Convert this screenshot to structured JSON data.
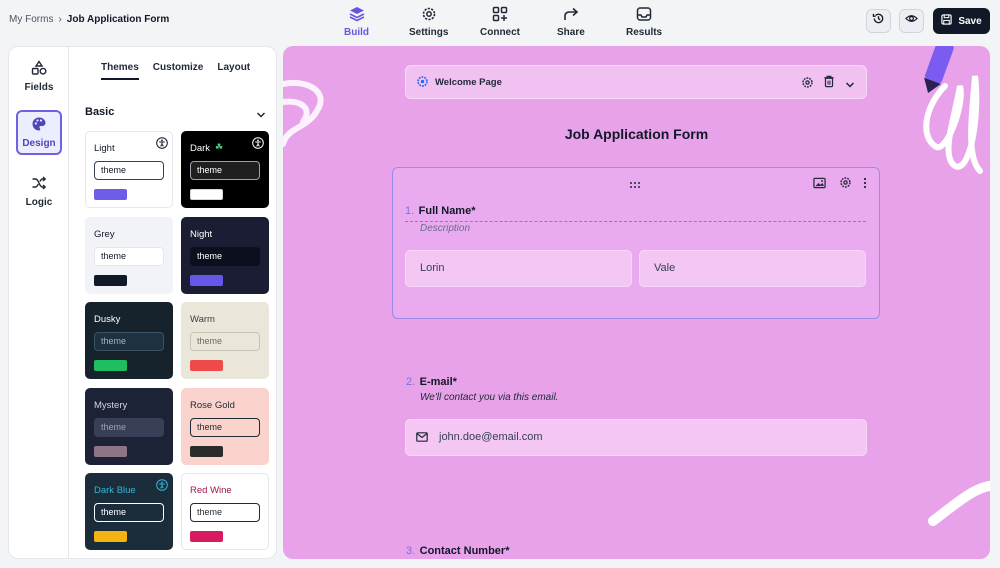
{
  "breadcrumb": {
    "root": "My Forms",
    "current": "Job Application Form"
  },
  "nav": [
    {
      "label": "Build",
      "icon": "layers-icon",
      "active": true
    },
    {
      "label": "Settings",
      "icon": "gear-icon",
      "active": false
    },
    {
      "label": "Connect",
      "icon": "grid-plus-icon",
      "active": false
    },
    {
      "label": "Share",
      "icon": "share-arrow-icon",
      "active": false
    },
    {
      "label": "Results",
      "icon": "inbox-icon",
      "active": false
    }
  ],
  "toolbar": {
    "save_label": "Save"
  },
  "rail": {
    "fields": "Fields",
    "design": "Design",
    "logic": "Logic"
  },
  "subtabs": {
    "themes": "Themes",
    "customize": "Customize",
    "layout": "Layout"
  },
  "section": {
    "title": "Basic"
  },
  "themes": [
    {
      "name": "Light",
      "input": "theme",
      "bg": "#ffffff",
      "fg": "#111827",
      "inputBg": "#ffffff",
      "inputBorder": "#374151",
      "inputFg": "#111827",
      "swatch": "#6d5ee6",
      "accessible": true
    },
    {
      "name": "Dark",
      "input": "theme",
      "bg": "#000000",
      "fg": "#ffffff",
      "inputBg": "#1f1f1f",
      "inputBorder": "#9ca3af",
      "inputFg": "#ffffff",
      "swatch": "#ffffff",
      "accessible": true
    },
    {
      "name": "Grey",
      "input": "theme",
      "bg": "#f1f3f9",
      "fg": "#111827",
      "inputBg": "#ffffff",
      "inputBorder": "#e5e7eb",
      "inputFg": "#111827",
      "swatch": "#111827",
      "accessible": false
    },
    {
      "name": "Night",
      "input": "theme",
      "bg": "#1a1d33",
      "fg": "#ffffff",
      "inputBg": "#0d0f1e",
      "inputBorder": "#0d0f1e",
      "inputFg": "#ffffff",
      "swatch": "#6558e6",
      "accessible": false
    },
    {
      "name": "Dusky",
      "input": "theme",
      "bg": "#16232d",
      "fg": "#ffffff",
      "inputBg": "#1e3140",
      "inputBorder": "#3a5363",
      "inputFg": "#9fb3c0",
      "swatch": "#1fbf5f",
      "accessible": false
    },
    {
      "name": "Warm",
      "input": "theme",
      "bg": "#ebe6da",
      "fg": "#374151",
      "inputBg": "#ebe6da",
      "inputBorder": "#c9c3b6",
      "inputFg": "#6b6b6b",
      "swatch": "#ef4a4a",
      "accessible": false
    },
    {
      "name": "Mystery",
      "input": "theme",
      "bg": "#1c2337",
      "fg": "#d1d5db",
      "inputBg": "#3a3f58",
      "inputBorder": "#3a3f58",
      "inputFg": "#9ca3af",
      "swatch": "#8e7586",
      "accessible": false
    },
    {
      "name": "Rose Gold",
      "input": "theme",
      "bg": "#fbd3cd",
      "fg": "#1f2937",
      "inputBg": "#fbd3cd",
      "inputBorder": "#1f2937",
      "inputFg": "#1f2937",
      "swatch": "#2b2b2b",
      "accessible": false
    },
    {
      "name": "Dark Blue",
      "input": "theme",
      "bg": "#1b2c3b",
      "fg": "#33b7dd",
      "inputBg": "#1b2c3b",
      "inputBorder": "#ffffff",
      "inputFg": "#ffffff",
      "swatch": "#f5b312",
      "accessible": true
    },
    {
      "name": "Red Wine",
      "input": "theme",
      "bg": "#ffffff",
      "fg": "#9d174d",
      "inputBg": "#ffffff",
      "inputBorder": "#1f2937",
      "inputFg": "#1f2937",
      "swatch": "#d81b60",
      "accessible": false
    }
  ],
  "canvas": {
    "welcome_label": "Welcome Page",
    "form_title": "Job Application Form",
    "questions": [
      {
        "number": "1.",
        "title": "Full Name*",
        "description": "Description",
        "first": "Lorin",
        "last": "Vale"
      },
      {
        "number": "2.",
        "title": "E-mail*",
        "hint": "We'll contact you via this email.",
        "value": "john.doe@email.com"
      },
      {
        "number": "3.",
        "title": "Contact Number*"
      }
    ]
  },
  "colors": {
    "accent": "#6358dc",
    "canvas_bg": "#e8a2ea",
    "save_bg": "#111827"
  }
}
